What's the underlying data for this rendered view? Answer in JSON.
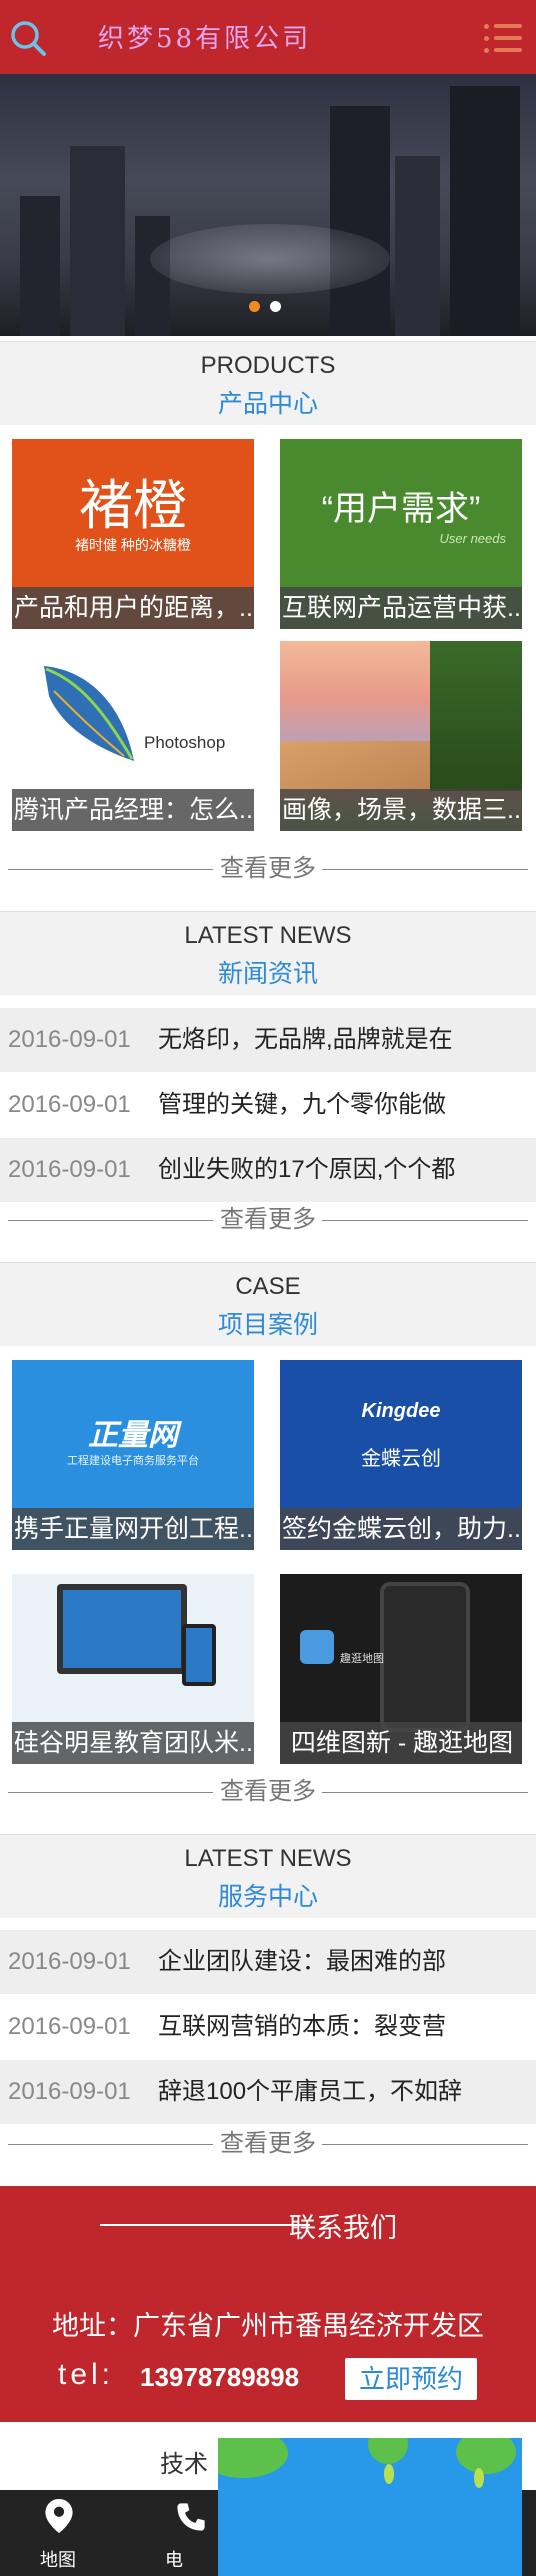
{
  "header": {
    "logo_text": "织梦58有限公司",
    "search_icon": "search-icon",
    "menu_icon": "menu-icon",
    "brand_color": "#c0272d"
  },
  "banner": {
    "slide_count": 2,
    "active_slide": 1,
    "dot_active_color": "#f08a24",
    "dot_inactive_color": "#ffffff"
  },
  "products": {
    "title_en": "PRODUCTS",
    "title_cn": "产品中心",
    "items": [
      {
        "caption": "产品和用户的距离，...",
        "image_text": "褚橙",
        "image_sub": "褚时健 种的冰糖橙"
      },
      {
        "caption": "互联网产品运营中获...",
        "image_text": "“用户需求”",
        "image_sub": "User needs"
      },
      {
        "caption": "腾讯产品经理：怎么...",
        "image_text": "Photoshop"
      },
      {
        "caption": "画像，场景，数据三..."
      }
    ],
    "more_label": "查看更多"
  },
  "news": {
    "title_en": "LATEST NEWS",
    "title_cn": "新闻资讯",
    "rows": [
      {
        "date": "2016-09-01",
        "title": "无烙印，无品牌,品牌就是在"
      },
      {
        "date": "2016-09-01",
        "title": "管理的关键，九个零你能做"
      },
      {
        "date": "2016-09-01",
        "title": "创业失败的17个原因,个个都"
      }
    ],
    "more_label": "查看更多"
  },
  "cases": {
    "title_en": "CASE",
    "title_cn": "项目案例",
    "items": [
      {
        "caption": "携手正量网开创工程...",
        "image_text": "正量网",
        "image_sub": "工程建设电子商务服务平台"
      },
      {
        "caption": "签约金蝶云创，助力...",
        "image_text": "Kingdee",
        "image_sub": "金蝶云创"
      },
      {
        "caption": "硅谷明星教育团队米..."
      },
      {
        "caption": "四维图新 - 趣逛地图",
        "image_text": "趣逛地图"
      }
    ],
    "more_label": "查看更多"
  },
  "service": {
    "title_en": "LATEST NEWS",
    "title_cn": "服务中心",
    "rows": [
      {
        "date": "2016-09-01",
        "title": "企业团队建设：最困难的部"
      },
      {
        "date": "2016-09-01",
        "title": "互联网营销的本质：裂变营"
      },
      {
        "date": "2016-09-01",
        "title": "辞退100个平庸员工，不如辞"
      }
    ],
    "more_label": "查看更多"
  },
  "contact": {
    "title": "联系我们",
    "address": "地址：广东省广州市番禺经济开发区",
    "tel_label": "tel:",
    "tel_number": "13978789898",
    "book_button": "立即预约"
  },
  "footer": {
    "tech_text": "技术",
    "nav": [
      {
        "label": "地图",
        "icon": "map-pin-icon"
      },
      {
        "label": "电",
        "icon": "phone-icon"
      }
    ]
  },
  "colors": {
    "accent_blue": "#2d8ad8",
    "section_bg": "#f2f2f2",
    "caption_bg": "#464646"
  }
}
